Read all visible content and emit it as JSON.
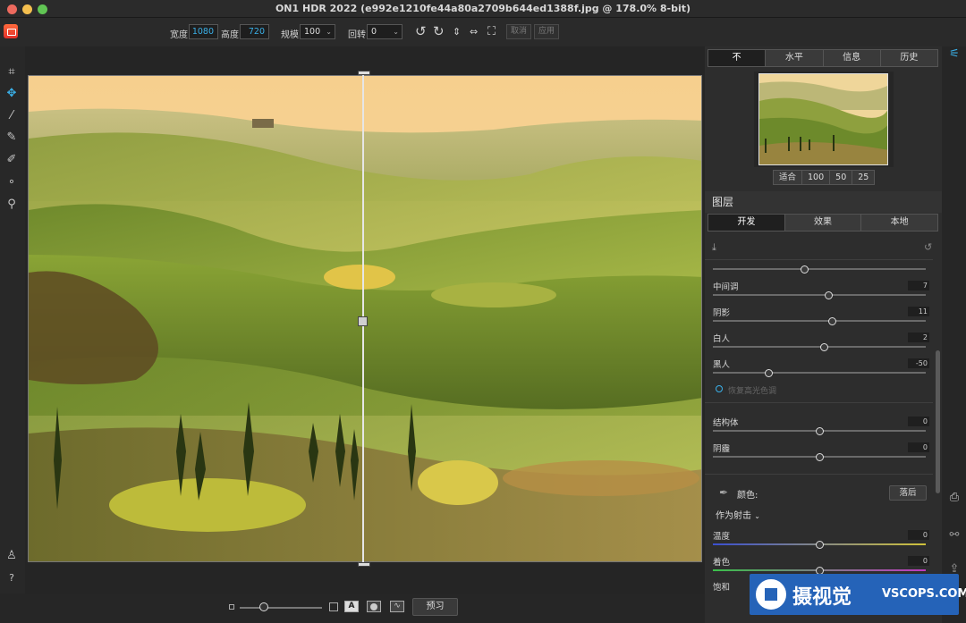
{
  "window": {
    "title": "ON1 HDR 2022 (e992e1210fe44a80a2709b644ed1388f.jpg @ 178.0% 8-bit)"
  },
  "toolbar": {
    "width_label": "宽度",
    "width_value": "1080",
    "height_label": "高度",
    "height_value": "720",
    "scale_label": "规模",
    "scale_value": "100",
    "rotate_label": "回转",
    "rotate_value": "0",
    "cancel_label": "取消",
    "apply_label": "应用"
  },
  "panel": {
    "top_tabs": [
      "不",
      "水平",
      "信息",
      "历史"
    ],
    "zoom_options": [
      "适合",
      "100",
      "50",
      "25"
    ],
    "layers_title": "图层",
    "sub_tabs": [
      "开发",
      "效果",
      "本地"
    ]
  },
  "sliders": [
    {
      "label": "",
      "value": "",
      "level": 0.43
    },
    {
      "label": "中间调",
      "value": "7",
      "level": 0.54
    },
    {
      "label": "阴影",
      "value": "11",
      "level": 0.56
    },
    {
      "label": "白人",
      "value": "2",
      "level": 0.52
    },
    {
      "label": "黑人",
      "value": "-50",
      "level": 0.26
    }
  ],
  "highlight_option": "恢复高光色调",
  "sliders2": [
    {
      "label": "结构体",
      "value": "0",
      "level": 0.5
    },
    {
      "label": "阴霾",
      "value": "0",
      "level": 0.5
    }
  ],
  "color": {
    "label": "颜色:",
    "reset_label": "落后",
    "mode": "作为射击"
  },
  "sliders3": [
    {
      "label": "温度",
      "value": "0",
      "level": 0.5
    },
    {
      "label": "着色",
      "value": "0",
      "level": 0.5
    }
  ],
  "saturation_label": "饱和",
  "bottom": {
    "preview_label": "预习"
  },
  "watermark": {
    "brand": "摄视觉",
    "site": "VSCOPS.COM"
  },
  "colors": {
    "accent": "#3ab0e8",
    "panel": "#2d2d2d",
    "watermark": "#2563b8"
  }
}
